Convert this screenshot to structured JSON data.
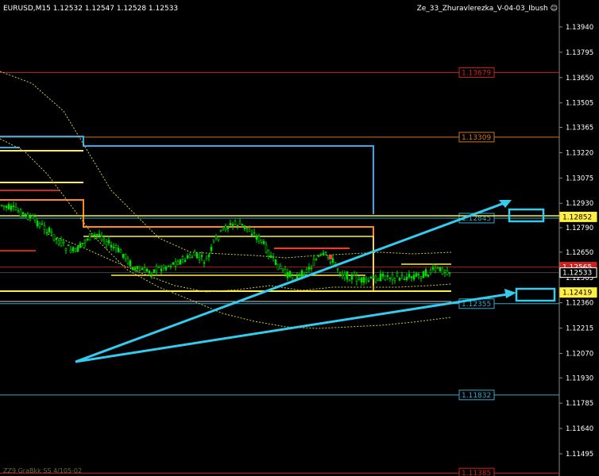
{
  "window": {
    "symbol_info": "EURUSD,M15  1.12532 1.12547 1.12528 1.12533",
    "indicator_name": "Ze_33_Zhuravlerezka_V-04-03_Ibush",
    "footer_note": "ZZ9 GraBkk SS 4/105-02"
  },
  "colors": {
    "background": "#000000",
    "candle_up": "#00dd00",
    "candle_down": "#00dd00",
    "grid": "#333333",
    "arrow": "#33ccee",
    "red_level": "#cc2222",
    "orange_level": "#cc7722",
    "cyan_level": "#33aacc",
    "yellow": "#ffee44"
  },
  "price_axis": {
    "min": 1.1138,
    "max": 1.1398,
    "ticks": [
      "1.13940",
      "1.13795",
      "1.13650",
      "1.13505",
      "1.13365",
      "1.13220",
      "1.13075",
      "1.12930",
      "1.12790",
      "1.12650",
      "1.12505",
      "1.12360",
      "1.12215",
      "1.12070",
      "1.11930",
      "1.11785",
      "1.11640",
      "1.11495"
    ]
  },
  "levels": [
    {
      "price": 1.13679,
      "label": "1.13679",
      "color": "#cc2222"
    },
    {
      "price": 1.13309,
      "label": "1.13309",
      "color": "#cc7722"
    },
    {
      "price": 1.12845,
      "label": "1.12845",
      "color": "#33aacc"
    },
    {
      "price": 1.12355,
      "label": "1.12355",
      "color": "#33aacc"
    },
    {
      "price": 1.11832,
      "label": "1.11832",
      "color": "#33aacc"
    },
    {
      "price": 1.11385,
      "label": "1.11385",
      "color": "#cc2222"
    }
  ],
  "price_tags": [
    {
      "price": 1.12852,
      "label": "1.12852",
      "bg": "#ffee44",
      "fg": "#000000"
    },
    {
      "price": 1.12565,
      "label": "1.12565",
      "bg": "#cc2222",
      "fg": "#ffffff"
    },
    {
      "price": 1.12533,
      "label": "1.12533",
      "bg": "#000000",
      "fg": "#ffffff"
    },
    {
      "price": 1.12419,
      "label": "1.12419",
      "bg": "#ffee44",
      "fg": "#000000"
    }
  ]
}
